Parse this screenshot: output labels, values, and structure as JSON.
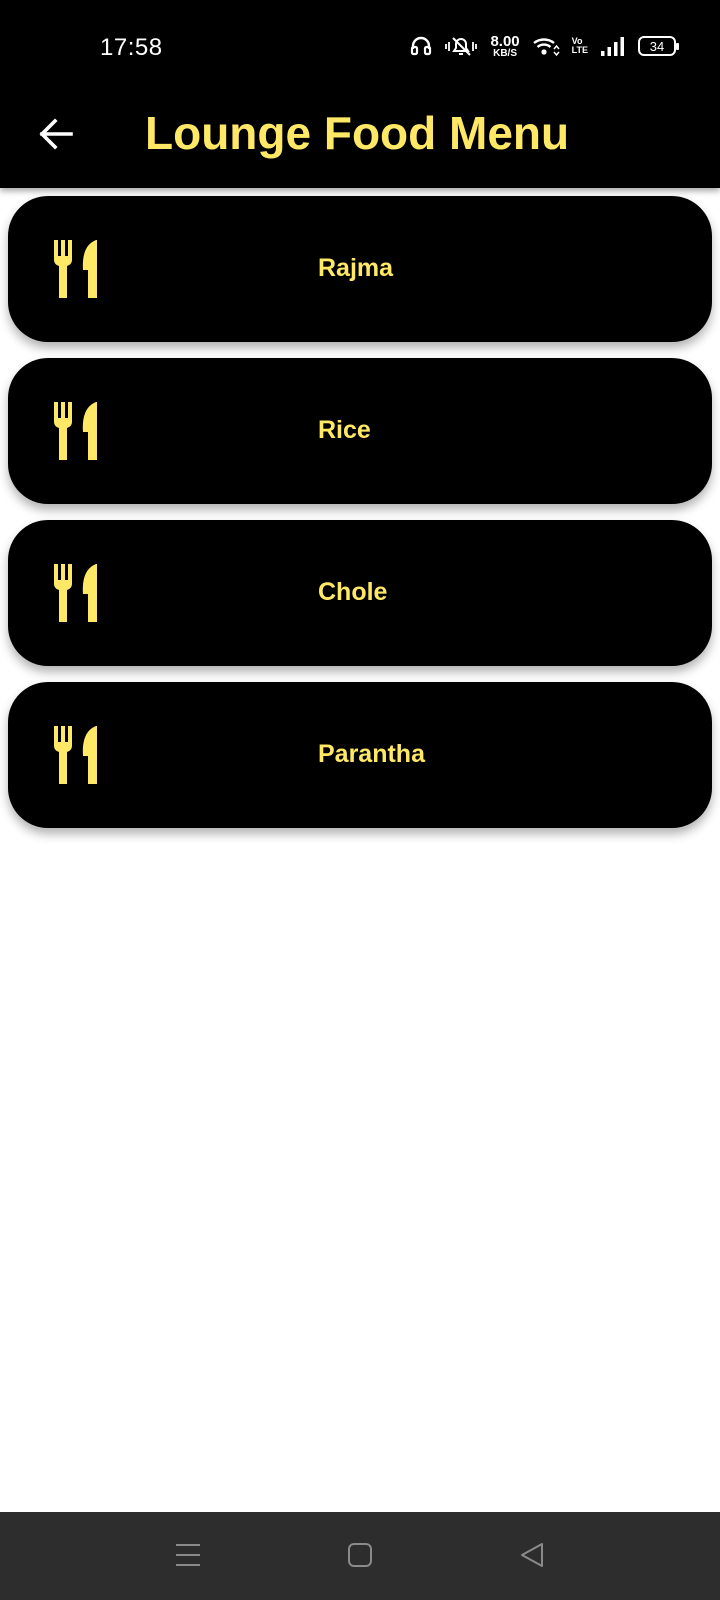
{
  "status_bar": {
    "time": "17:58",
    "net_speed_value": "8.00",
    "net_speed_unit": "KB/S",
    "volte_top": "Vo",
    "volte_bottom": "LTE",
    "battery_level": "34"
  },
  "app_bar": {
    "title": "Lounge Food Menu",
    "back_icon": "arrow-left-icon"
  },
  "menu": {
    "items": [
      {
        "label": "Rajma",
        "icon": "fork-knife-icon"
      },
      {
        "label": "Rice",
        "icon": "fork-knife-icon"
      },
      {
        "label": "Chole",
        "icon": "fork-knife-icon"
      },
      {
        "label": "Parantha",
        "icon": "fork-knife-icon"
      }
    ]
  },
  "nav_bar": {
    "buttons": [
      "menu-lines-icon",
      "home-square-icon",
      "back-triangle-icon"
    ]
  },
  "colors": {
    "accent": "#ffe866",
    "bar_background": "#000000",
    "nav_background": "#2d2d2d",
    "page_background": "#ffffff"
  }
}
